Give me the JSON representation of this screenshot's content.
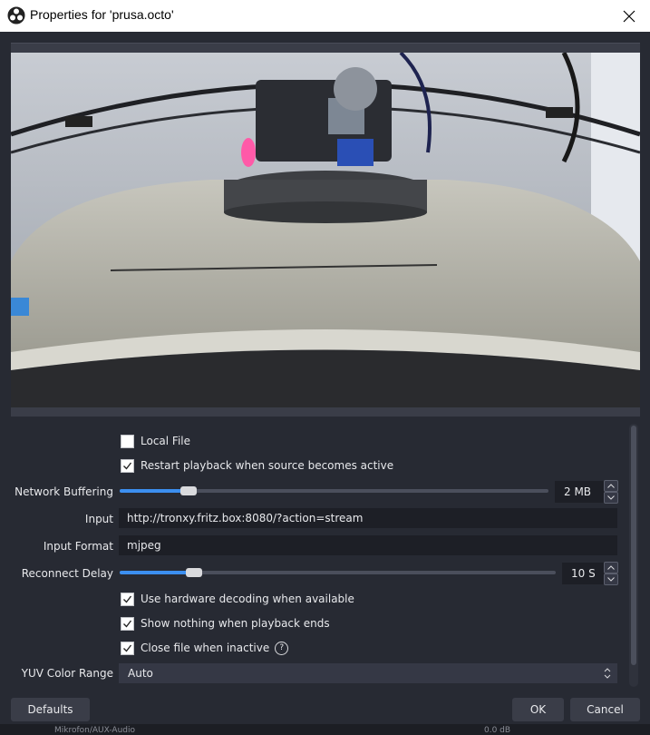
{
  "window": {
    "title": "Properties for 'prusa.octo'",
    "close_icon": "close-icon",
    "app_icon": "obs-logo-icon"
  },
  "preview": {
    "description_icon": "camera-preview"
  },
  "form": {
    "local_file": {
      "label": "Local File",
      "checked": false
    },
    "restart_playback": {
      "label": "Restart playback when source becomes active",
      "checked": true
    },
    "network_buffering": {
      "label": "Network Buffering",
      "value": "2 MB",
      "level": 0.16
    },
    "input": {
      "label": "Input",
      "value": "http://tronxy.fritz.box:8080/?action=stream"
    },
    "input_format": {
      "label": "Input Format",
      "value": "mjpeg"
    },
    "reconnect_delay": {
      "label": "Reconnect Delay",
      "value": "10 S",
      "level": 0.17
    },
    "hw_decoding": {
      "label": "Use hardware decoding when available",
      "checked": true
    },
    "show_nothing": {
      "label": "Show nothing when playback ends",
      "checked": true
    },
    "close_file": {
      "label": "Close file when inactive",
      "checked": true,
      "help_symbol": "?"
    },
    "yuv_color_range": {
      "label": "YUV Color Range",
      "value": "Auto"
    }
  },
  "buttons": {
    "defaults": "Defaults",
    "ok": "OK",
    "cancel": "Cancel"
  },
  "background_strip": {
    "left_text": "Mikrofon/AUX-Audio",
    "right_text": "0.0 dB"
  },
  "colors": {
    "accent": "#3c8ff0",
    "panel": "#272a33",
    "field": "#1d1f26"
  }
}
